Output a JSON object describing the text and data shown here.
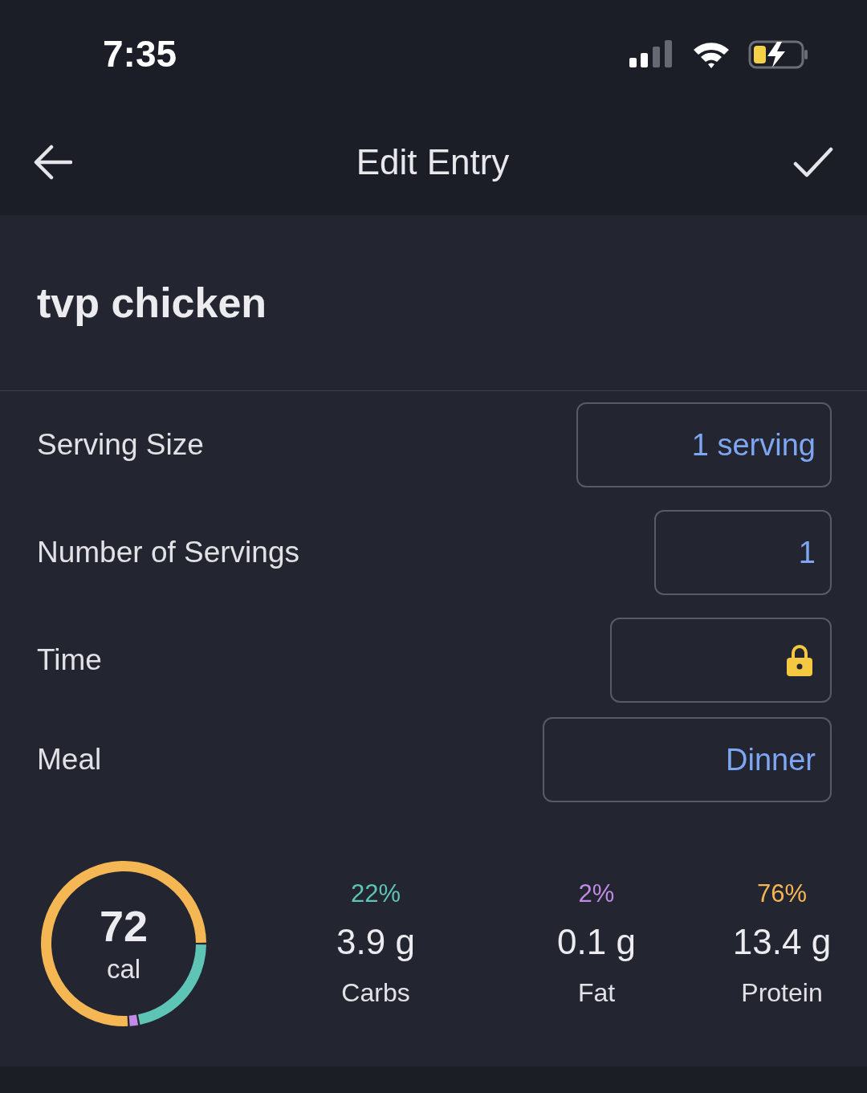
{
  "status_bar": {
    "time": "7:35"
  },
  "header": {
    "title": "Edit Entry"
  },
  "food": {
    "name": "tvp chicken"
  },
  "fields": [
    {
      "label": "Serving Size",
      "kind": "text",
      "value": "1 serving"
    },
    {
      "label": "Number of Servings",
      "kind": "text",
      "value": "1"
    },
    {
      "label": "Time",
      "kind": "locked"
    },
    {
      "label": "Meal",
      "kind": "text",
      "value": "Dinner"
    }
  ],
  "calories": {
    "value": "72",
    "unit": "cal",
    "chart_data": {
      "type": "donut",
      "categories": [
        "Carbs",
        "Fat",
        "Protein"
      ],
      "series": [
        {
          "values": [
            22,
            2,
            76
          ]
        }
      ]
    }
  },
  "macros": [
    {
      "percent": "22%",
      "amount": "3.9 g",
      "color": "#5ec4b6"
    },
    {
      "percent": "2%",
      "amount": "0.1 g",
      "color": "#c08ae6"
    },
    {
      "percent": "76%",
      "amount": "13.4 g",
      "color": "#f5b754"
    }
  ]
}
